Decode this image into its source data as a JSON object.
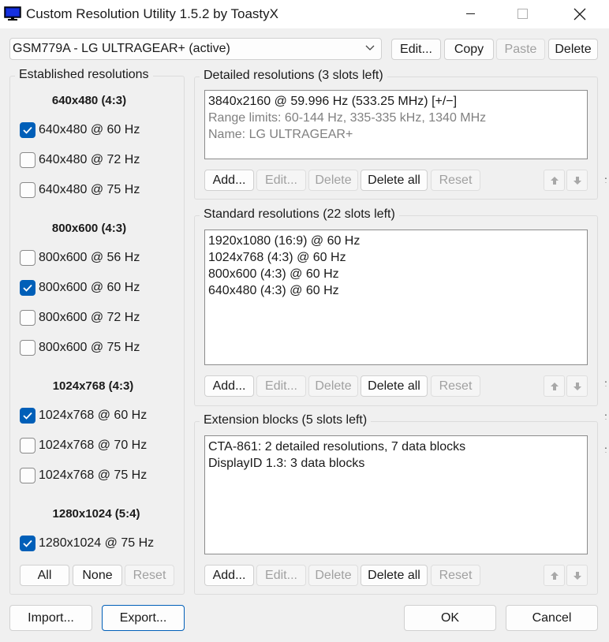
{
  "window": {
    "title": "Custom Resolution Utility 1.5.2 by ToastyX"
  },
  "monitor": {
    "selected": "GSM779A - LG ULTRAGEAR+ (active)"
  },
  "top_buttons": {
    "edit": "Edit...",
    "copy": "Copy",
    "paste": "Paste",
    "delete": "Delete"
  },
  "established": {
    "title": "Established resolutions",
    "groups": [
      {
        "heading": "640x480 (4:3)",
        "items": [
          {
            "label": "640x480 @ 60 Hz",
            "checked": true
          },
          {
            "label": "640x480 @ 72 Hz",
            "checked": false
          },
          {
            "label": "640x480 @ 75 Hz",
            "checked": false
          }
        ]
      },
      {
        "heading": "800x600 (4:3)",
        "items": [
          {
            "label": "800x600 @ 56 Hz",
            "checked": false
          },
          {
            "label": "800x600 @ 60 Hz",
            "checked": true
          },
          {
            "label": "800x600 @ 72 Hz",
            "checked": false
          },
          {
            "label": "800x600 @ 75 Hz",
            "checked": false
          }
        ]
      },
      {
        "heading": "1024x768 (4:3)",
        "items": [
          {
            "label": "1024x768 @ 60 Hz",
            "checked": true
          },
          {
            "label": "1024x768 @ 70 Hz",
            "checked": false
          },
          {
            "label": "1024x768 @ 75 Hz",
            "checked": false
          }
        ]
      },
      {
        "heading": "1280x1024 (5:4)",
        "items": [
          {
            "label": "1280x1024 @ 75 Hz",
            "checked": true
          }
        ]
      }
    ],
    "buttons": {
      "all": "All",
      "none": "None",
      "reset": "Reset"
    }
  },
  "detailed": {
    "title": "Detailed resolutions (3 slots left)",
    "lines": [
      "3840x2160 @ 59.996 Hz (533.25 MHz) [+/−]",
      "Range limits: 60-144 Hz, 335-335 kHz, 1340 MHz",
      "Name: LG ULTRAGEAR+"
    ]
  },
  "standard": {
    "title": "Standard resolutions (22 slots left)",
    "lines": [
      "1920x1080 (16:9) @ 60 Hz",
      "1024x768 (4:3) @ 60 Hz",
      "800x600 (4:3) @ 60 Hz",
      "640x480 (4:3) @ 60 Hz"
    ]
  },
  "extension": {
    "title": "Extension blocks (5 slots left)",
    "lines": [
      "CTA-861: 2 detailed resolutions, 7 data blocks",
      "DisplayID 1.3: 3 data blocks"
    ]
  },
  "list_buttons": {
    "add": "Add...",
    "edit": "Edit...",
    "delete": "Delete",
    "delete_all": "Delete all",
    "reset": "Reset"
  },
  "bottom": {
    "import": "Import...",
    "export": "Export...",
    "ok": "OK",
    "cancel": "Cancel"
  },
  "colors": {
    "accent": "#005fb8",
    "window_bg": "#f0f0f0",
    "disabled_text": "#a0a0a0"
  }
}
